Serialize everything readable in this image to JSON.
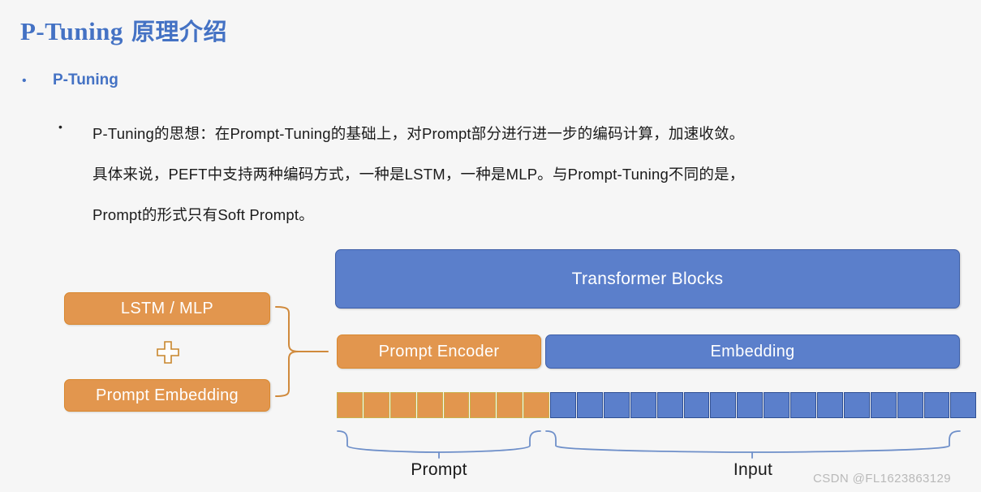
{
  "slide": {
    "title_en": "P-Tuning",
    "title_cn": "原理介绍",
    "title_color": "#4472C4"
  },
  "bullets": {
    "level1": {
      "marker": "•",
      "label": "P-Tuning"
    },
    "level2": {
      "marker": "•",
      "lines": [
        "P-Tuning的思想：在Prompt-Tuning的基础上，对Prompt部分进行进一步的编码计算，加速收敛。",
        "具体来说，PEFT中支持两种编码方式，一种是LSTM，一种是MLP。与Prompt-Tuning不同的是，",
        "Prompt的形式只有Soft Prompt。"
      ]
    }
  },
  "diagram": {
    "boxes": {
      "transformer_blocks": "Transformer Blocks",
      "prompt_encoder": "Prompt Encoder",
      "embedding": "Embedding",
      "lstm_mlp": "LSTM / MLP",
      "prompt_embedding": "Prompt Embedding"
    },
    "plus_icon": "plus-icon",
    "connector_icon": "right-curly-brace-icon",
    "tokens": {
      "orange_count": 8,
      "blue_count": 16,
      "orange_color": "#E2964E",
      "blue_color": "#5B7FCB"
    },
    "brace_labels": {
      "prompt": "Prompt",
      "input": "Input"
    }
  },
  "watermark": "CSDN @FL1623863129"
}
